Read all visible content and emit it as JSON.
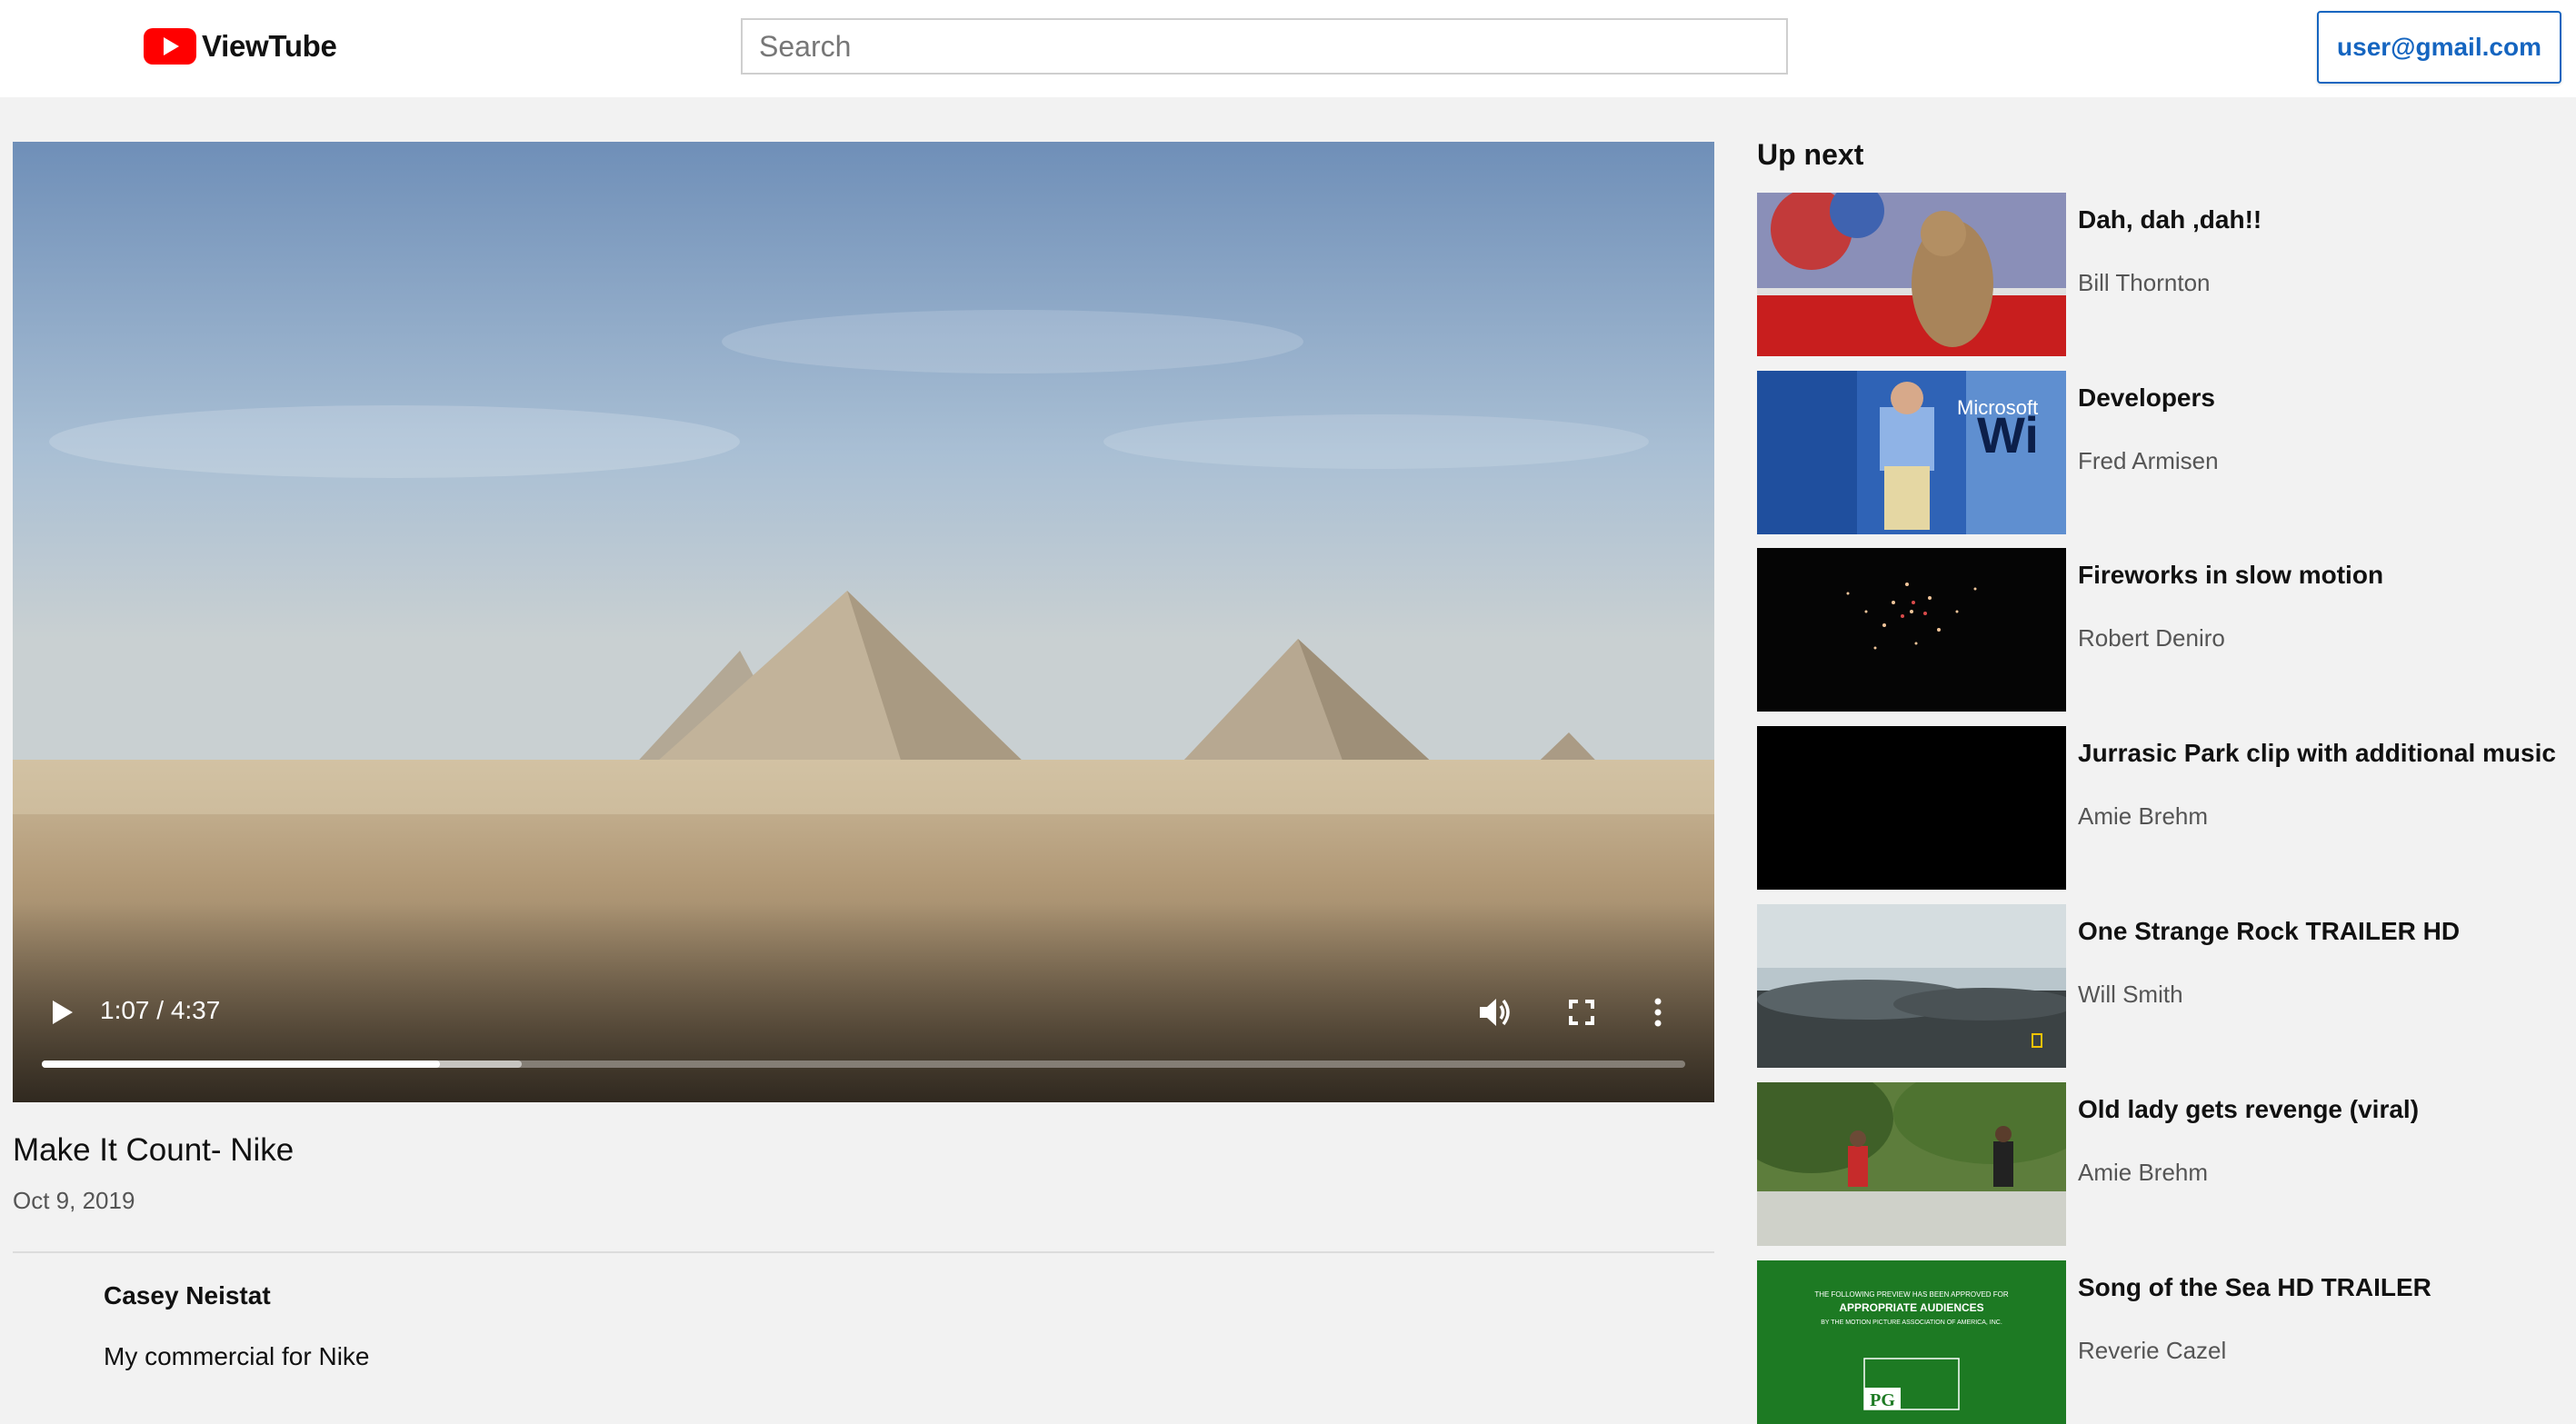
{
  "app": {
    "name": "ViewTube"
  },
  "search": {
    "placeholder": "Search"
  },
  "account": {
    "label": "user@gmail.com"
  },
  "player": {
    "current_time": "1:07",
    "duration": "4:37",
    "time_display": "1:07 / 4:37",
    "progress_fraction": 0.242,
    "buffered_fraction": 0.292
  },
  "video": {
    "title": "Make It Count- Nike",
    "date": "Oct 9, 2019",
    "channel": "Casey Neistat",
    "description": "My commercial for Nike"
  },
  "up_next": {
    "heading": "Up next",
    "items": [
      {
        "title": "Dah, dah ,dah!!",
        "author": "Bill Thornton"
      },
      {
        "title": "Developers",
        "author": "Fred Armisen"
      },
      {
        "title": "Fireworks in slow motion",
        "author": "Robert Deniro"
      },
      {
        "title": "Jurrasic Park clip with additional music",
        "author": "Amie Brehm"
      },
      {
        "title": "One Strange Rock TRAILER HD",
        "author": "Will Smith"
      },
      {
        "title": "Old lady gets revenge (viral)",
        "author": "Amie Brehm"
      },
      {
        "title": "Song of the Sea HD TRAILER",
        "author": "Reverie Cazel"
      }
    ]
  },
  "thumbnail_text": {
    "rating_line1": "THE FOLLOWING PREVIEW HAS BEEN APPROVED FOR",
    "rating_line2": "APPROPRIATE AUDIENCES",
    "rating_line3": "BY THE MOTION PICTURE ASSOCIATION OF AMERICA, INC.",
    "rating_badge": "PG",
    "microsoft_text": "Microsoft",
    "windows_text": "Wi"
  },
  "colors": {
    "brand_red": "#ff0000",
    "account_blue": "#1565c0",
    "page_bg": "#f2f2f2"
  },
  "icons": {
    "logo": "play-logo-icon",
    "play": "play-icon",
    "volume": "volume-icon",
    "fullscreen": "fullscreen-icon",
    "more": "more-vert-icon"
  }
}
